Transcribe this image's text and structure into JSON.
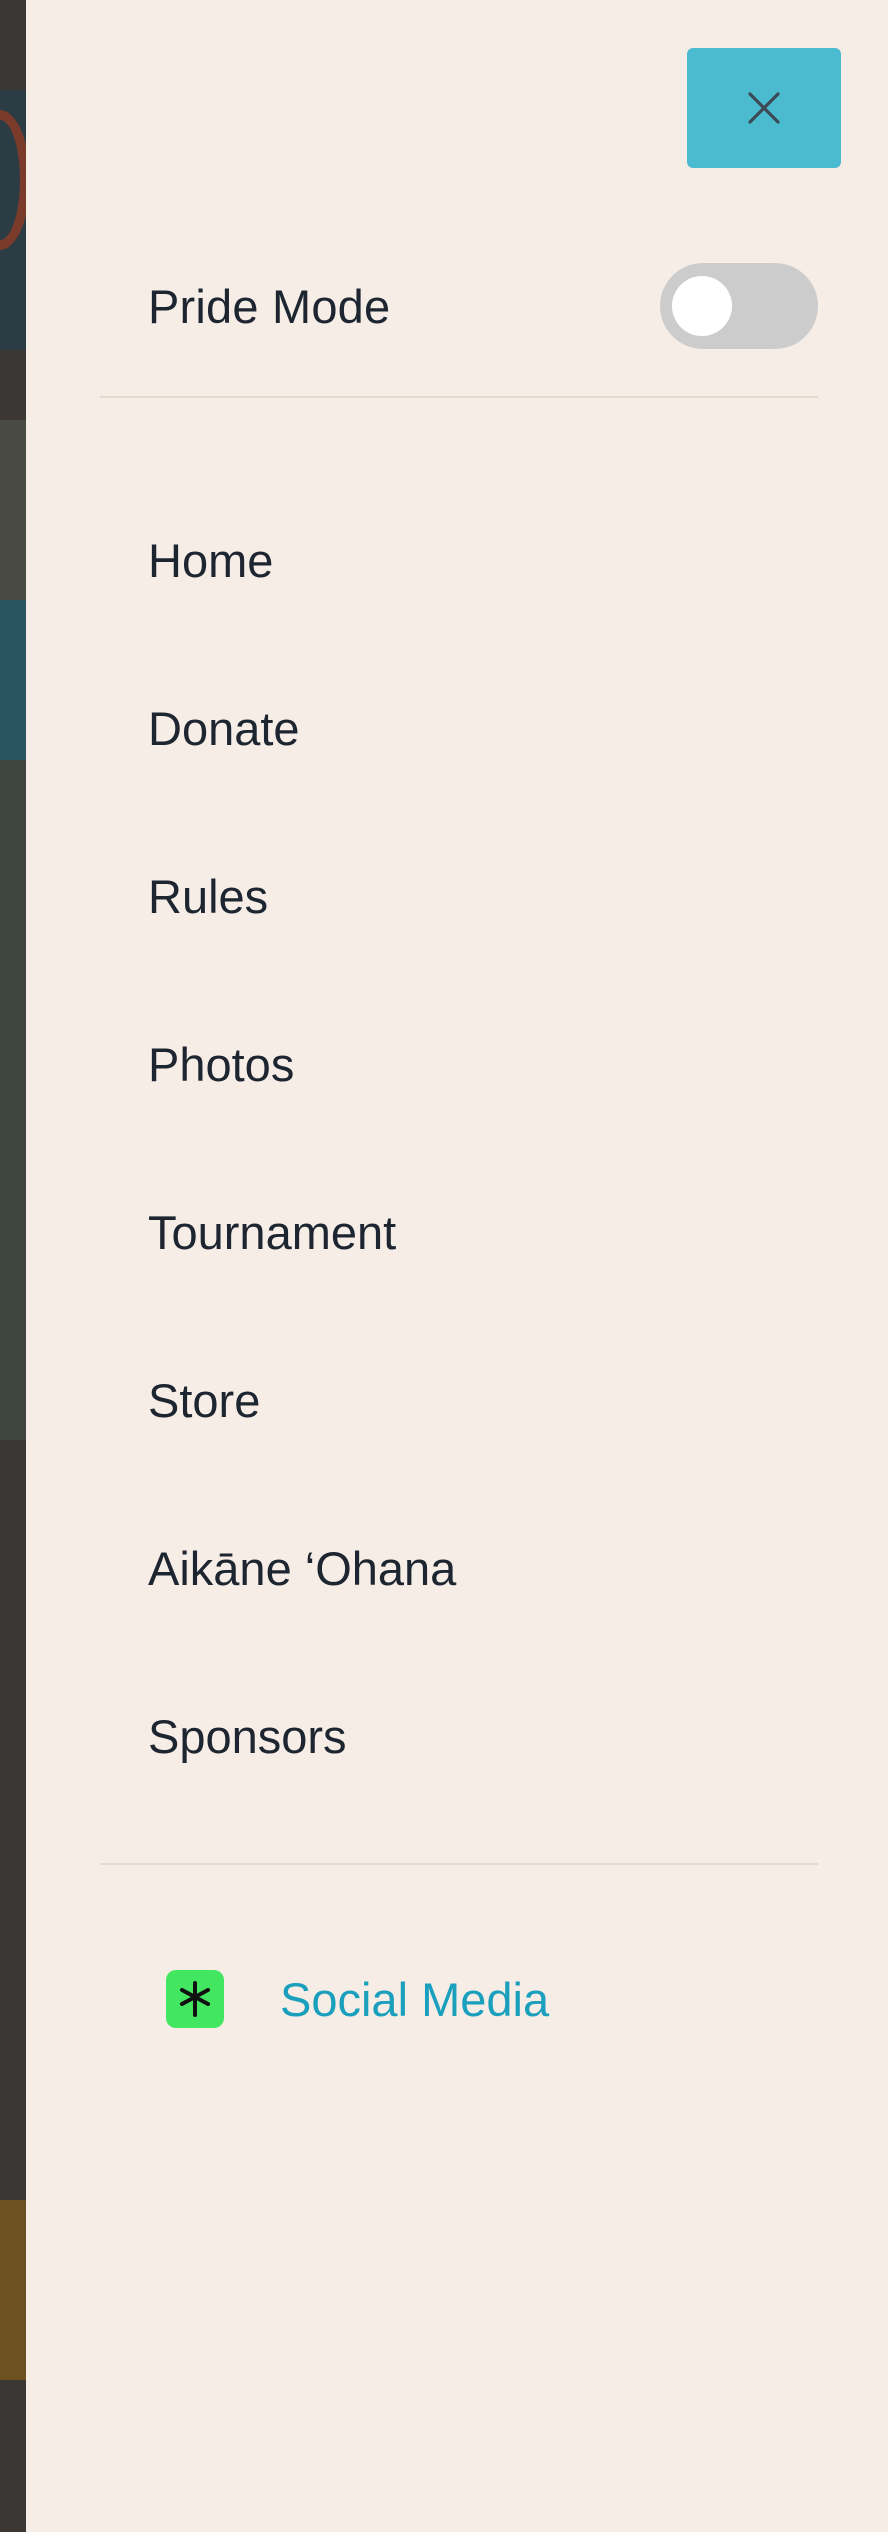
{
  "drawer": {
    "close_icon": "close-icon",
    "pride_mode": {
      "label": "Pride Mode",
      "enabled": false
    },
    "nav_items": [
      {
        "label": "Home"
      },
      {
        "label": "Donate"
      },
      {
        "label": "Rules"
      },
      {
        "label": "Photos"
      },
      {
        "label": "Tournament"
      },
      {
        "label": "Store"
      },
      {
        "label": "Aikāne ‘Ohana"
      },
      {
        "label": "Sponsors"
      }
    ],
    "social": {
      "label": "Social Media",
      "icon": "linktree-icon"
    }
  },
  "colors": {
    "drawer_bg": "#f5ede6",
    "close_button": "#4bbcd0",
    "toggle_off": "#cccccc",
    "link": "#1a9fbc",
    "linktree_green": "#43e660",
    "text": "#1d2530"
  }
}
